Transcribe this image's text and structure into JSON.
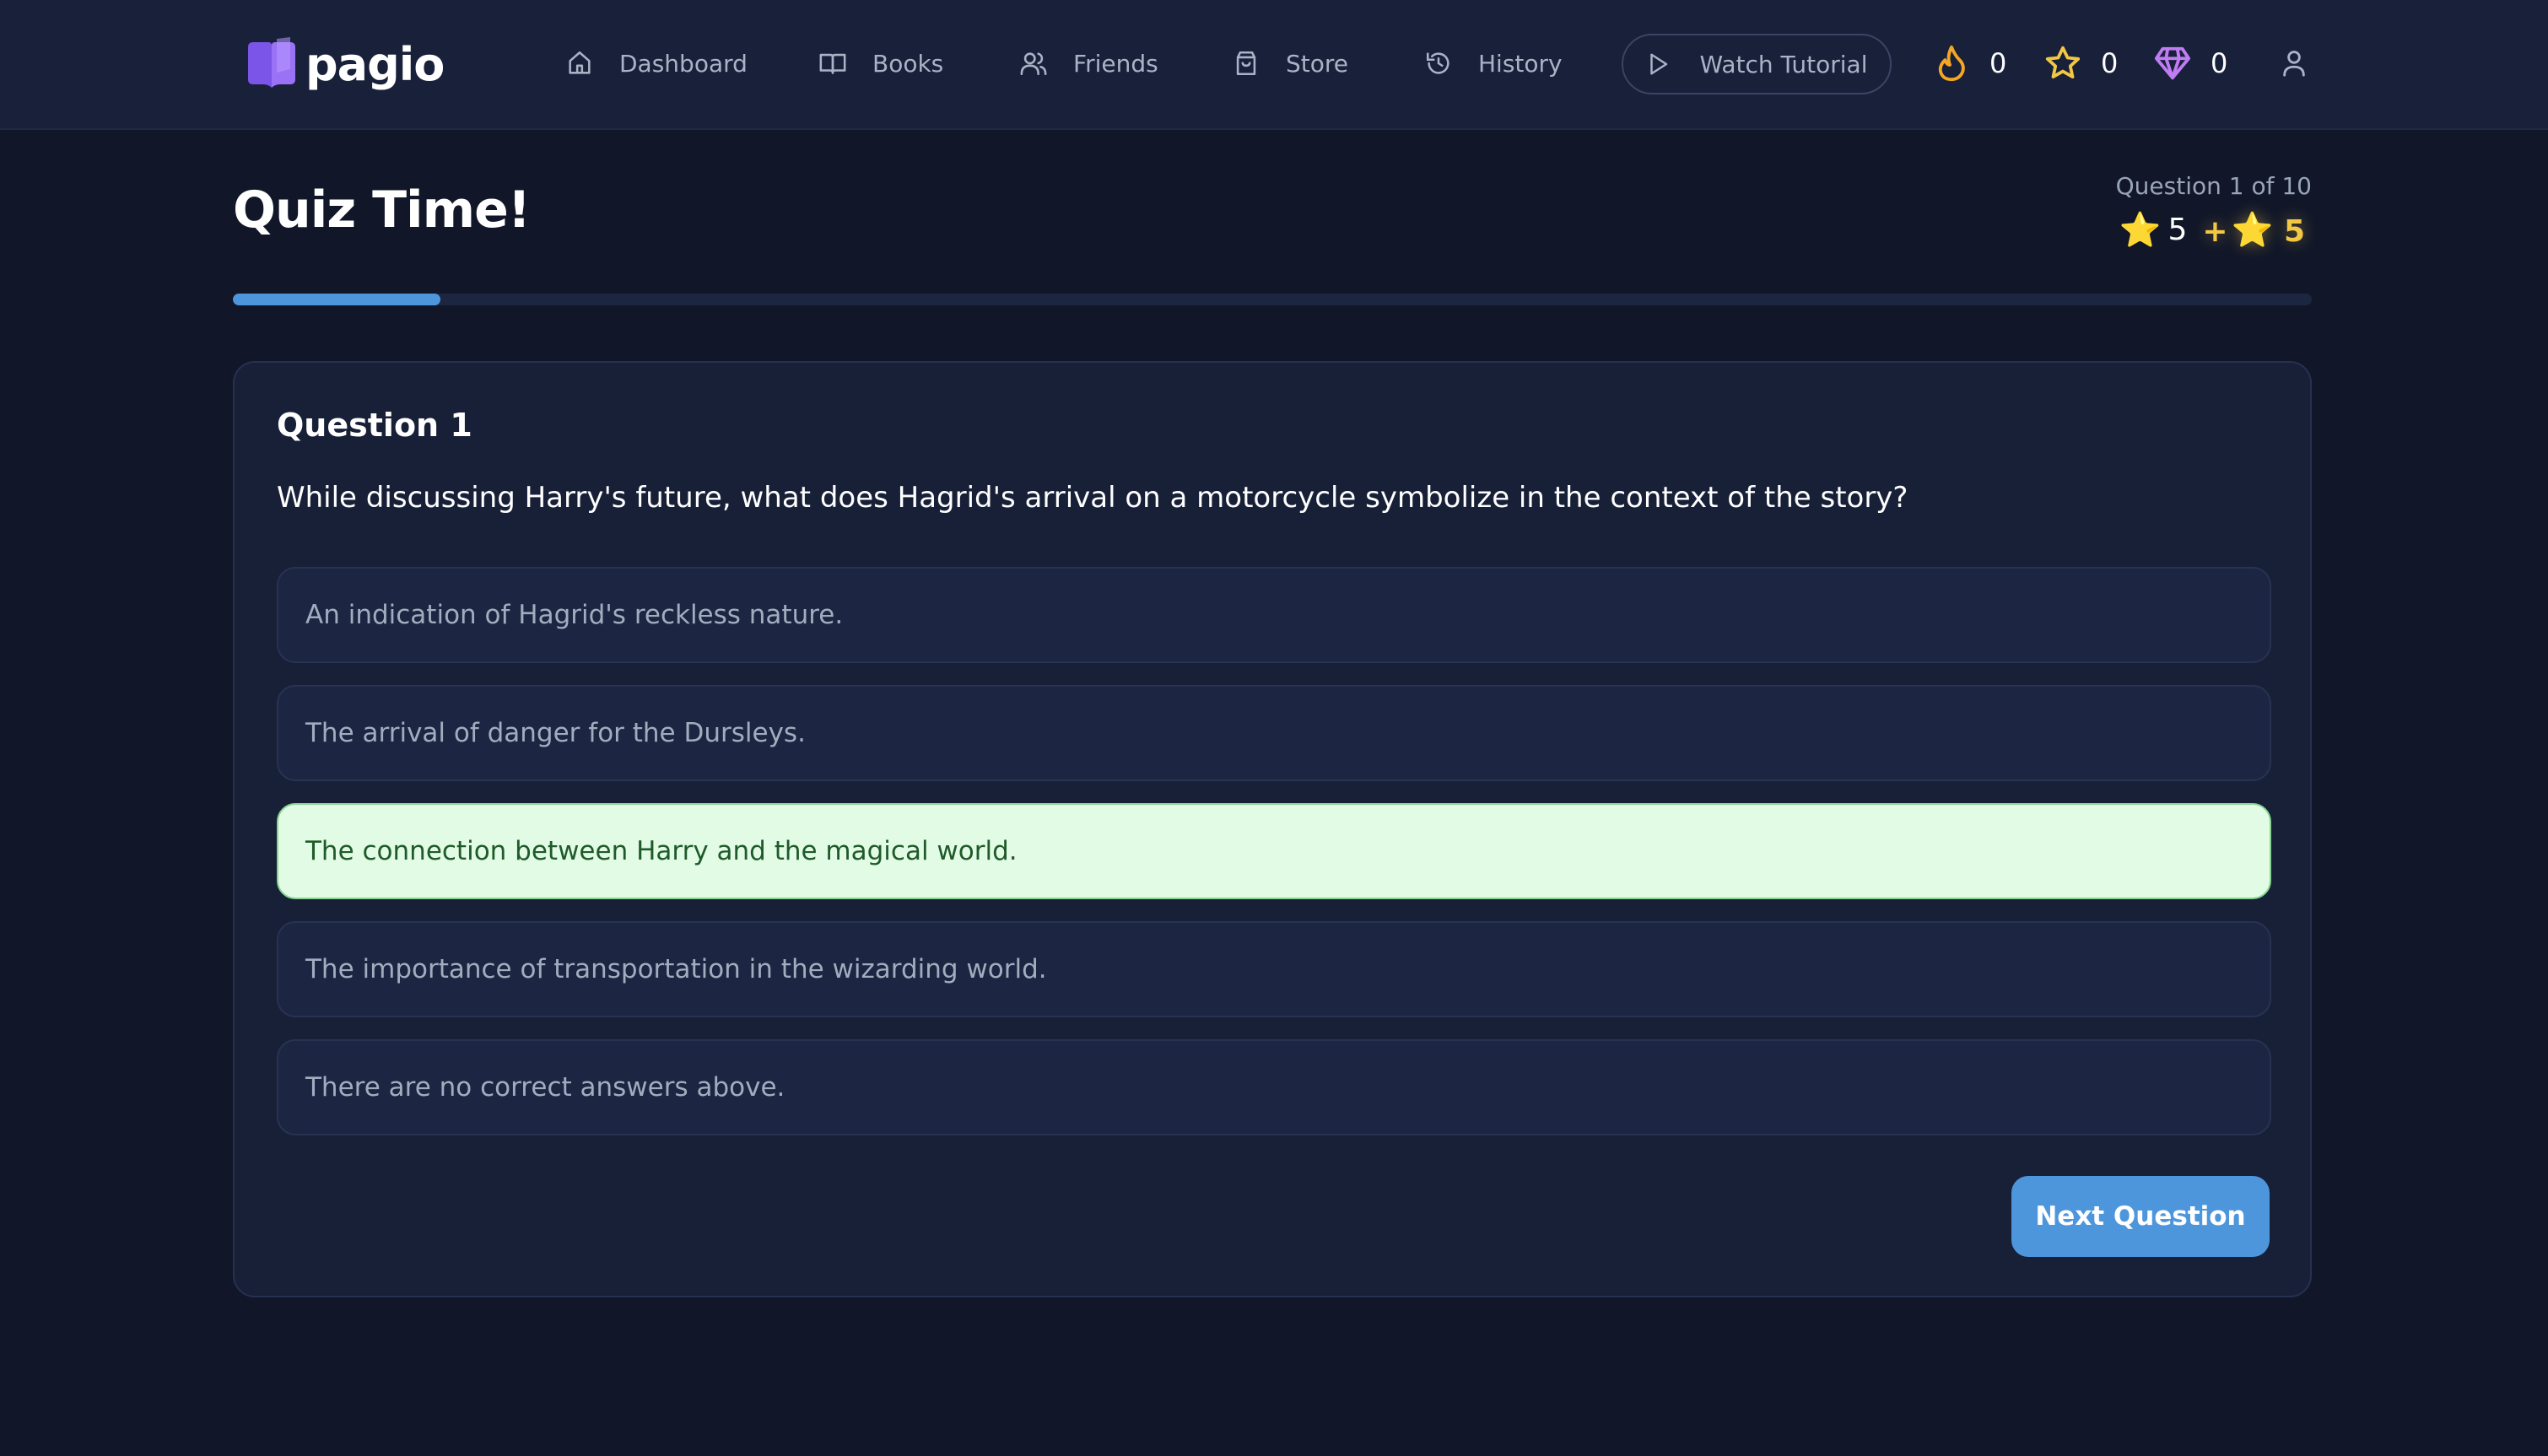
{
  "brand": {
    "name": "pagio"
  },
  "nav": {
    "items": [
      {
        "label": "Dashboard",
        "icon": "home-icon"
      },
      {
        "label": "Books",
        "icon": "book-open-icon"
      },
      {
        "label": "Friends",
        "icon": "users-icon"
      },
      {
        "label": "Store",
        "icon": "shopping-bag-icon"
      },
      {
        "label": "History",
        "icon": "history-icon"
      }
    ],
    "tutorial_label": "Watch Tutorial",
    "stats": {
      "streak": "0",
      "stars": "0",
      "gems": "0"
    }
  },
  "quiz": {
    "title": "Quiz Time!",
    "progress_label": "Question 1 of 10",
    "progress_fraction": 0.1,
    "score_base": "5",
    "score_gain": "5",
    "question_heading": "Question 1",
    "question_text": "While discussing Harry's future, what does Hagrid's arrival on a motorcycle symbolize in the context of the story?",
    "options": [
      "An indication of Hagrid's reckless nature.",
      "The arrival of danger for the Dursleys.",
      "The connection between Harry and the magical world.",
      "The importance of transportation in the wizarding world.",
      "There are no correct answers above."
    ],
    "selected_option": 2,
    "next_label": "Next Question"
  },
  "colors": {
    "background": "#111729",
    "topbar": "#18203a",
    "accent": "#4e96dc",
    "selected_bg": "#e2fbe5",
    "selected_border": "#86d48f",
    "streak": "#f5a623",
    "star": "#f2c744",
    "gem": "#c07cf2",
    "logo": "#7b55e8"
  }
}
